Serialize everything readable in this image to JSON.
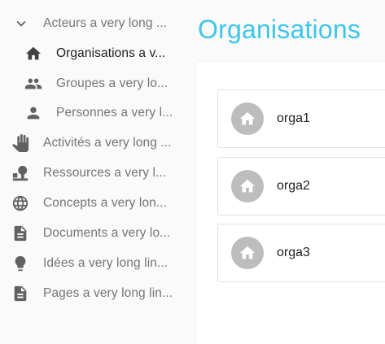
{
  "page": {
    "title": "Organisations"
  },
  "sidebar": {
    "items": [
      {
        "label": "Acteurs a very long ...",
        "icon": "chevron-down-icon"
      },
      {
        "label": "Organisations a v...",
        "icon": "home-icon"
      },
      {
        "label": "Groupes a very lo...",
        "icon": "people-icon"
      },
      {
        "label": "Personnes a very l...",
        "icon": "person-icon"
      },
      {
        "label": "Activités a very long ...",
        "icon": "hand-icon"
      },
      {
        "label": "Ressources a very l...",
        "icon": "resource-icon"
      },
      {
        "label": "Concepts a very lon...",
        "icon": "globe-icon"
      },
      {
        "label": "Documents a very lo...",
        "icon": "document-icon"
      },
      {
        "label": "Idées a very long lin...",
        "icon": "lightbulb-icon"
      },
      {
        "label": "Pages a very long lin...",
        "icon": "page-icon"
      }
    ]
  },
  "organisations": [
    {
      "name": "orga1",
      "icon": "home-icon"
    },
    {
      "name": "orga2",
      "icon": "home-icon"
    },
    {
      "name": "orga3",
      "icon": "home-icon"
    }
  ],
  "colors": {
    "title": "#3ec6ea",
    "avatar": "#bdbdbd"
  }
}
